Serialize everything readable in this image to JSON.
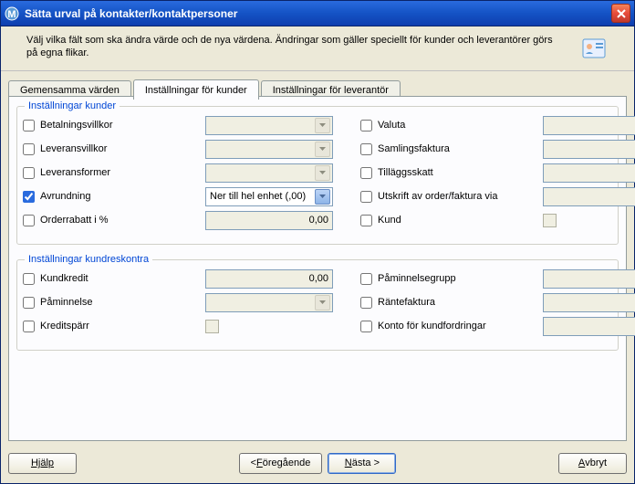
{
  "window": {
    "title": "Sätta urval på kontakter/kontaktpersoner"
  },
  "info": {
    "text": "Välj vilka fält som ska ändra värde och de nya värdena. Ändringar som gäller speciellt för kunder och leverantörer görs på egna flikar."
  },
  "tabs": {
    "common": "Gemensamma värden",
    "customers": "Inställningar för kunder",
    "vendors": "Inställningar för leverantör"
  },
  "group1": {
    "legend": "Inställningar kunder",
    "betalningsvillkor": "Betalningsvillkor",
    "leveransvillkor": "Leveransvillkor",
    "leveransformer": "Leveransformer",
    "avrundning": "Avrundning",
    "avrundning_value": "Ner till hel enhet (,00)",
    "orderrabatt": "Orderrabatt i %",
    "orderrabatt_value": "0,00",
    "valuta": "Valuta",
    "samlingsfaktura": "Samlingsfaktura",
    "tillagsskatt": "Tilläggsskatt",
    "utskrift": "Utskrift av order/faktura via",
    "kund": "Kund"
  },
  "group2": {
    "legend": "Inställningar kundreskontra",
    "kundkredit": "Kundkredit",
    "kundkredit_value": "0,00",
    "paminnelse": "Påminnelse",
    "kreditsparr": "Kreditspärr",
    "paminnelsegrupp": "Påminnelsegrupp",
    "rantefaktura": "Räntefaktura",
    "konto": "Konto för kundfordringar"
  },
  "buttons": {
    "help": "Hjälp",
    "prev_pre": "< ",
    "prev_u": "F",
    "prev_post": "öregående",
    "next_u": "N",
    "next_post": "ästa >",
    "cancel_u": "A",
    "cancel_post": "vbryt"
  }
}
